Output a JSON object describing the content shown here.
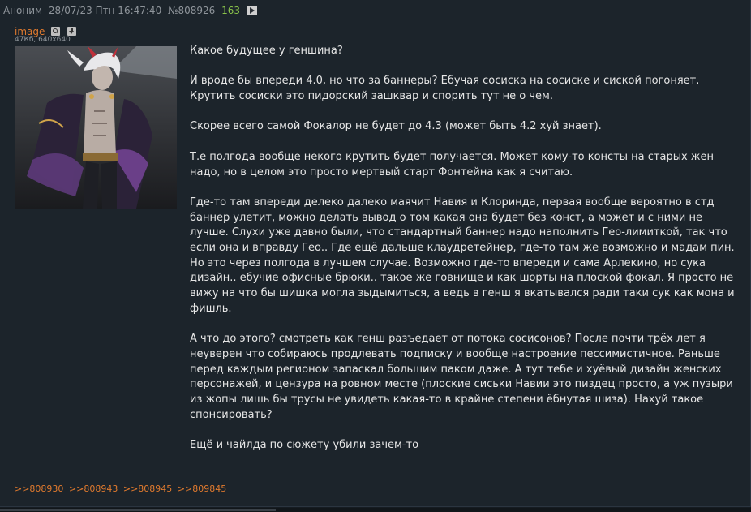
{
  "post": {
    "author": "Аноним",
    "datetime": "28/07/23 Птн 16:47:40",
    "number": "№808926",
    "reply_count": "163"
  },
  "file": {
    "name": "image",
    "meta": "47Кб, 640x640"
  },
  "body": [
    "Какое будущее у геншина?",
    "И вроде бы впереди 4.0, но что за баннеры? Ебучая сосиска на сосиске и сиской погоняет. Крутить сосиски это пидорский зашквар и спорить тут не о чем.",
    "Скорее всего самой Фокалор не будет до 4.3 (может быть 4.2 хуй знает).",
    "Т.е полгода вообще некого крутить будет получается. Может кому-то консты на старых жен надо, но в целом это просто мертвый старт Фонтейна как я считаю.",
    "Где-то там впереди делеко далеко маячит Навия и Клоринда, первая вообще вероятно в стд баннер улетит, можно делать вывод о том какая она будет без конст, а может и с ними не лучше. Слухи уже давно были, что стандартный баннер надо наполнить Гео-лимиткой, так что если она и вправду Гео.. Где ещё дальше клаудретейнер, где-то там же возможно и мадам пин. Но это через полгода в лучшем случае. Возможно где-то впереди и сама Арлекино, но сука дизайн.. ебучие офисные брюки.. такое же говнище и как шорты на плоской фокал. Я просто не вижу на что бы шишка могла зыдымиться, а ведь в генш я вкатывался ради таки сук как мона и фишль.",
    "А что до этого? смотреть как генш разъедает от потока сосисонов? После почти трёх лет я неуверен что собираюсь продлевать подписку и вообще настроение пессимистичное. Раньше перед каждым регионом запаскал большим паком даже. А тут тебе и хуёвый дизайн женских персонажей, и цензура на ровном месте (плоские сиськи Навии это пиздец просто, а уж пузыри из жопы лишь бы трусы не увидеть какая-то в крайне степени ёбнутая шиза). Нахуй такое спонсировать?",
    "Ещё и чайлда по сюжету убили зачем-то"
  ],
  "replies": [
    ">>808930",
    ">>808943",
    ">>808945",
    ">>809845"
  ],
  "colors": {
    "background": "#1c242b",
    "text": "#e6e6e6",
    "meta": "#8f959b",
    "count": "#89c24a",
    "link": "#e07a2e"
  },
  "icons": [
    "play-icon",
    "search-icon",
    "download-icon"
  ]
}
